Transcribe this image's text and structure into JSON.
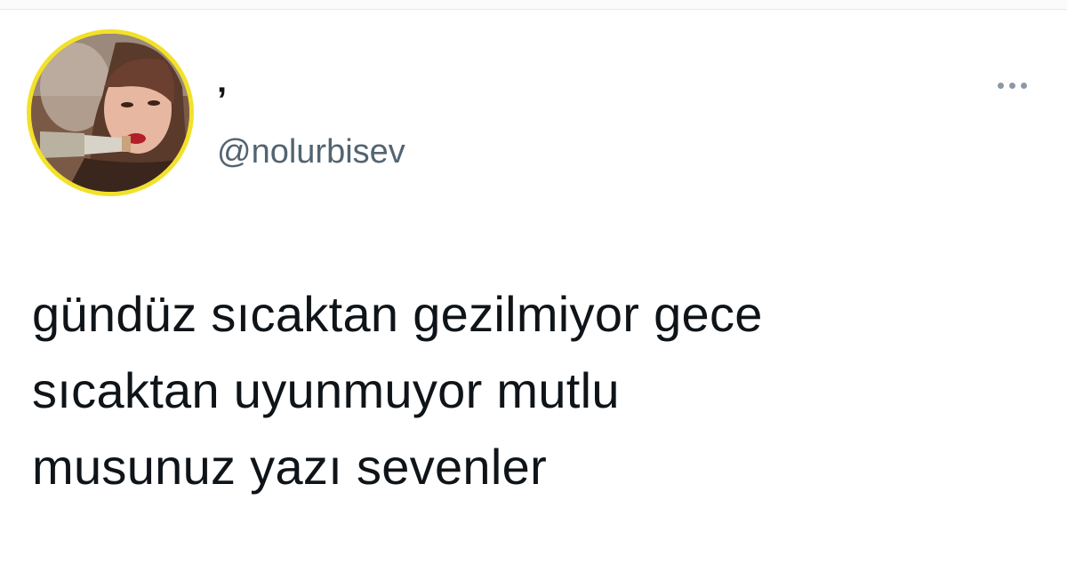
{
  "tweet": {
    "author": {
      "display_name": "’",
      "handle": "@nolurbisev",
      "avatar_icon": "profile-photo",
      "avatar_border_color": "#f2e12a"
    },
    "more_icon": "more-options-icon",
    "text_lines": [
      "gündüz sıcaktan gezilmiyor gece",
      "sıcaktan uyunmuyor mutlu",
      "musunuz yazı sevenler"
    ]
  },
  "colors": {
    "text_primary": "#0f1419",
    "text_secondary": "#536471",
    "icon_muted": "#8b98a5"
  }
}
